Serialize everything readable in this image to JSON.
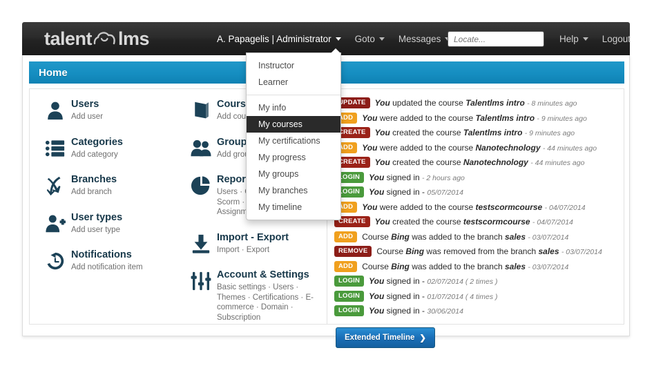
{
  "brand": {
    "name_part1": "talent",
    "name_part2": "lms",
    "logo_icon": "cloud-smile-icon"
  },
  "topnav": {
    "user_menu": "A. Papagelis | Administrator",
    "goto": "Goto",
    "messages": "Messages",
    "help": "Help",
    "logout": "Logout",
    "search_placeholder": "Locate...",
    "search_value": ""
  },
  "dropdown": {
    "group1": [
      "Instructor",
      "Learner"
    ],
    "group2": [
      "My info",
      "My courses",
      "My certifications",
      "My progress",
      "My groups",
      "My branches",
      "My timeline"
    ],
    "selected": "My courses"
  },
  "page": {
    "title": "Home"
  },
  "menu_col1": [
    {
      "icon": "user-icon",
      "title": "Users",
      "sub": "Add user"
    },
    {
      "icon": "list-icon",
      "title": "Categories",
      "sub": "Add category"
    },
    {
      "icon": "branches-icon",
      "title": "Branches",
      "sub": "Add branch"
    },
    {
      "icon": "user-plus-icon",
      "title": "User types",
      "sub": "Add user type"
    },
    {
      "icon": "clock-history-icon",
      "title": "Notifications",
      "sub": "Add notification item"
    }
  ],
  "menu_col2": [
    {
      "icon": "book-icon",
      "title": "Courses",
      "sub": "Add course"
    },
    {
      "icon": "group-icon",
      "title": "Groups",
      "sub": "Add group"
    },
    {
      "icon": "pie-chart-icon",
      "title": "Reports",
      "sub": "Users · Courses · Groups · Scorm · Tests · Surveys · Assignments · Custom"
    },
    {
      "icon": "download-icon",
      "title": "Import - Export",
      "sub": "Import · Export"
    },
    {
      "icon": "sliders-icon",
      "title": "Account & Settings",
      "sub": "Basic settings · Users · Themes · Certifications · E-commerce · Domain · Subscription"
    }
  ],
  "timeline": {
    "entries": [
      {
        "badge": "UPDATE",
        "color": "#8c1d18",
        "pre": "",
        "actor": "You",
        "mid": " updated the course ",
        "object": "Talentlms intro",
        "time": "- 8 minutes ago"
      },
      {
        "badge": "ADD",
        "color": "#f0a01e",
        "pre": "",
        "actor": "You",
        "mid": " were added to the course ",
        "object": "Talentlms intro",
        "time": "- 9 minutes ago"
      },
      {
        "badge": "CREATE",
        "color": "#9b2218",
        "pre": "",
        "actor": "You",
        "mid": " created the course ",
        "object": "Talentlms intro",
        "time": "- 9 minutes ago"
      },
      {
        "badge": "ADD",
        "color": "#f0a01e",
        "pre": "",
        "actor": "You",
        "mid": " were added to the course ",
        "object": "Nanotechnology",
        "time": "- 44 minutes ago"
      },
      {
        "badge": "CREATE",
        "color": "#9b2218",
        "pre": "",
        "actor": "You",
        "mid": " created the course ",
        "object": "Nanotechnology",
        "time": "- 44 minutes ago"
      },
      {
        "badge": "LOGIN",
        "color": "#4a9a3c",
        "pre": "",
        "actor": "You",
        "mid": " signed in ",
        "object": "",
        "time": "- 2 hours ago"
      },
      {
        "badge": "LOGIN",
        "color": "#4a9a3c",
        "pre": "",
        "actor": "You",
        "mid": " signed in - ",
        "object": "",
        "time": "05/07/2014"
      },
      {
        "badge": "ADD",
        "color": "#f0a01e",
        "pre": "",
        "actor": "You",
        "mid": " were added to the course ",
        "object": "testscormcourse",
        "time": "- 04/07/2014"
      },
      {
        "badge": "CREATE",
        "color": "#9b2218",
        "pre": "",
        "actor": "You",
        "mid": " created the course ",
        "object": "testscormcourse",
        "time": "- 04/07/2014"
      },
      {
        "badge": "ADD",
        "color": "#f0a01e",
        "pre": "Course ",
        "actor": "Bing",
        "mid": " was added to the branch ",
        "object": "sales",
        "time": "- 03/07/2014"
      },
      {
        "badge": "REMOVE",
        "color": "#8c1d18",
        "pre": "Course ",
        "actor": "Bing",
        "mid": " was removed from the branch ",
        "object": "sales",
        "time": "- 03/07/2014"
      },
      {
        "badge": "ADD",
        "color": "#f0a01e",
        "pre": "Course ",
        "actor": "Bing",
        "mid": " was added to the branch ",
        "object": "sales",
        "time": "- 03/07/2014"
      },
      {
        "badge": "LOGIN",
        "color": "#4a9a3c",
        "pre": "",
        "actor": "You",
        "mid": " signed in - ",
        "object": "",
        "time": "02/07/2014 ( 2 times )"
      },
      {
        "badge": "LOGIN",
        "color": "#4a9a3c",
        "pre": "",
        "actor": "You",
        "mid": " signed in - ",
        "object": "",
        "time": "01/07/2014 ( 4 times )"
      },
      {
        "badge": "LOGIN",
        "color": "#4a9a3c",
        "pre": "",
        "actor": "You",
        "mid": " signed in - ",
        "object": "",
        "time": "30/06/2014"
      }
    ],
    "button_label": "Extended Timeline",
    "button_arrow": "❯"
  },
  "colors": {
    "accent_blue": "#1a8fc4",
    "dark_header": "#232323",
    "icon_navy": "#1c4257"
  }
}
